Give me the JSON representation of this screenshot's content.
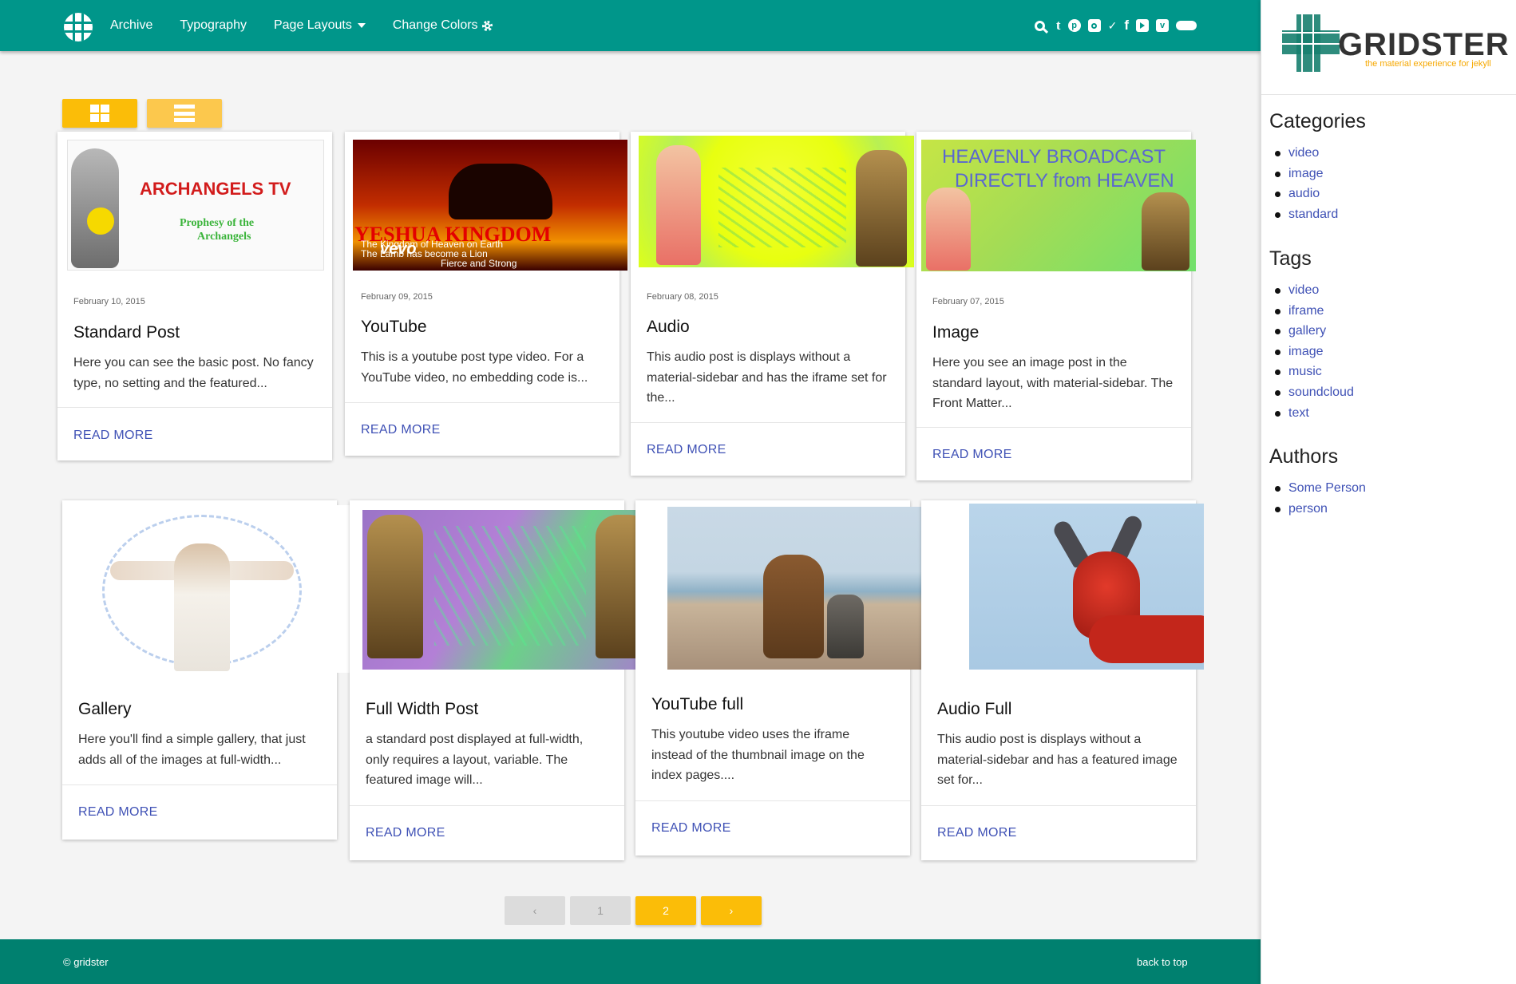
{
  "nav": {
    "links": [
      {
        "label": "Archive"
      },
      {
        "label": "Typography"
      },
      {
        "label": "Page Layouts"
      },
      {
        "label": "Change Colors"
      }
    ],
    "social_icons": [
      "search-icon",
      "tumblr-icon",
      "pinterest-icon",
      "instagram-icon",
      "twitter-icon",
      "facebook-icon",
      "youtube-icon",
      "vimeo-icon",
      "soundcloud-icon"
    ],
    "tumblr_glyph": "t",
    "facebook_glyph": "f",
    "vimeo_glyph": "v"
  },
  "colors": {
    "primary": "#00968a",
    "footer": "#00806f",
    "accent": "#fbbd08",
    "link": "#3f51b5"
  },
  "brand": {
    "title": "GRIDSTER",
    "subtitle": "the material experience for jekyll"
  },
  "sidebar": {
    "categories": {
      "heading": "Categories",
      "items": [
        "video",
        "image",
        "audio",
        "standard"
      ]
    },
    "tags": {
      "heading": "Tags",
      "items": [
        "video",
        "iframe",
        "gallery",
        "image",
        "music",
        "soundcloud",
        "text"
      ]
    },
    "authors": {
      "heading": "Authors",
      "items": [
        "Some Person",
        "person"
      ]
    }
  },
  "cards": [
    {
      "date": "February 10, 2015",
      "title": "Standard Post",
      "excerpt": "Here you can see the basic post. No fancy type, no setting and the featured...",
      "more": "READ MORE",
      "image": {
        "heading": "ARCHANGELS TV",
        "line1": "Prophesy of the",
        "line2": "Archangels"
      }
    },
    {
      "date": "February 09, 2015",
      "title": "YouTube",
      "excerpt": "This is a youtube post type video. For a YouTube video, no embedding code is...",
      "more": "READ MORE",
      "image": {
        "heading": "YESHUA KINGDOM",
        "line1": "The Kingdom of Heaven on Earth",
        "line2": "The Lamb has become a Lion",
        "line3": "Fierce and Strong",
        "badge": "vevo"
      }
    },
    {
      "date": "February 08, 2015",
      "title": "Audio",
      "excerpt": "This audio post is displays without a material-sidebar and has the iframe set for the...",
      "more": "READ MORE"
    },
    {
      "date": "February 07, 2015",
      "title": "Image",
      "excerpt": "Here you see an image post in the standard layout, with material-sidebar. The Front Matter...",
      "more": "READ MORE",
      "image": {
        "line1": "HEAVENLY    BROADCAST",
        "line2": "DIRECTLY from HEAVEN"
      }
    },
    {
      "title": "Gallery",
      "excerpt": "Here you'll find a simple gallery, that just adds all of the images at full-width...",
      "more": "READ MORE"
    },
    {
      "title": "Full Width Post",
      "excerpt": "a standard post displayed at full-width, only requires a layout, variable. The featured image will...",
      "more": "READ MORE"
    },
    {
      "title": "YouTube full",
      "excerpt": "This youtube video uses the iframe instead of the thumbnail image on the index pages....",
      "more": "READ MORE"
    },
    {
      "title": "Audio Full",
      "excerpt": "This audio post is displays without a material-sidebar and has a featured image set for...",
      "more": "READ MORE"
    }
  ],
  "pagination": {
    "prev": "‹",
    "pages": [
      "1",
      "2"
    ],
    "current": "2",
    "next": "›"
  },
  "footer": {
    "copyright": "© gridster",
    "back_to_top": "back to top"
  }
}
